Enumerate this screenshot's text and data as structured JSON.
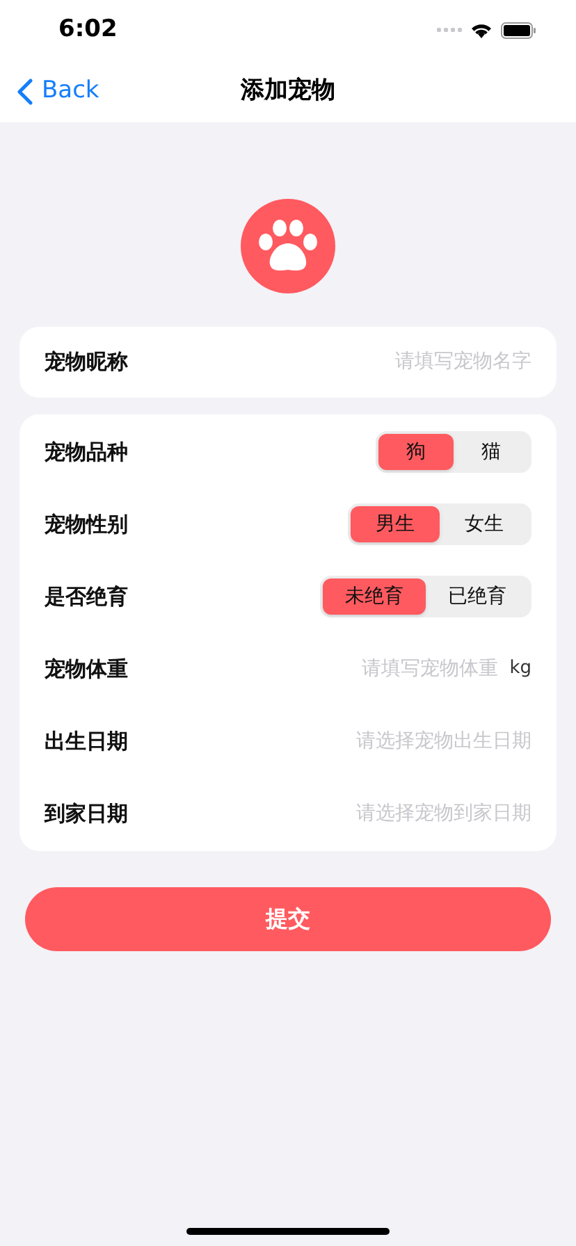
{
  "status_bar": {
    "time": "6:02"
  },
  "nav": {
    "back": "Back",
    "title": "添加宠物"
  },
  "nickname": {
    "label": "宠物昵称",
    "placeholder": "请填写宠物名字"
  },
  "rows": [
    {
      "kind": "segment",
      "label": "宠物品种",
      "options": [
        {
          "label": "狗",
          "selected": true
        },
        {
          "label": "猫",
          "selected": false
        }
      ]
    },
    {
      "kind": "segment",
      "label": "宠物性别",
      "options": [
        {
          "label": "男生",
          "selected": true
        },
        {
          "label": "女生",
          "selected": false
        }
      ]
    },
    {
      "kind": "segment",
      "label": "是否绝育",
      "options": [
        {
          "label": "未绝育",
          "selected": true
        },
        {
          "label": "已绝育",
          "selected": false
        }
      ]
    },
    {
      "kind": "input",
      "label": "宠物体重",
      "placeholder": "请填写宠物体重",
      "unit": "kg"
    },
    {
      "kind": "date",
      "label": "出生日期",
      "placeholder": "请选择宠物出生日期"
    },
    {
      "kind": "date",
      "label": "到家日期",
      "placeholder": "请选择宠物到家日期"
    }
  ],
  "submit": "提交"
}
